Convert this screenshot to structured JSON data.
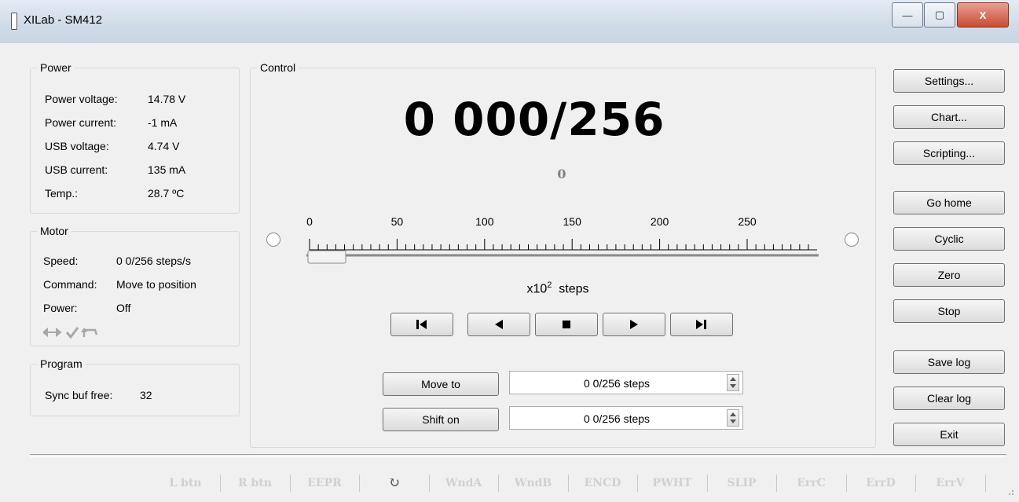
{
  "window": {
    "title": "XILab - SM412",
    "minimize_glyph": "—",
    "maximize_glyph": "▢",
    "close_glyph": "X"
  },
  "power": {
    "title": "Power",
    "rows": [
      {
        "label": "Power voltage:",
        "value": "14.78 V"
      },
      {
        "label": "Power current:",
        "value": "-1 mA"
      },
      {
        "label": "USB voltage:",
        "value": "4.74 V"
      },
      {
        "label": "USB current:",
        "value": "135 mA"
      },
      {
        "label": "Temp.:",
        "value": "28.7 ºC"
      }
    ]
  },
  "motor": {
    "title": "Motor",
    "rows": [
      {
        "label": "Speed:",
        "value": "0 0/256 steps/s"
      },
      {
        "label": "Command:",
        "value": "Move to position"
      },
      {
        "label": "Power:",
        "value": "Off"
      }
    ],
    "status_icons": [
      "arrows-icon",
      "check-icon",
      "return-icon"
    ]
  },
  "program": {
    "title": "Program",
    "sync_label": "Sync buf free:",
    "sync_value": "32"
  },
  "control": {
    "title": "Control",
    "position": "0 000/256",
    "encoder": "0",
    "scale_ticks": [
      "0",
      "50",
      "100",
      "150",
      "200",
      "250"
    ],
    "slider_value": 0,
    "units_prefix": "x10",
    "units_exp": "2",
    "units_suffix": "steps",
    "move_to_label": "Move to",
    "move_to_value": "0 0/256 steps",
    "shift_on_label": "Shift on",
    "shift_on_value": "0 0/256 steps"
  },
  "side_buttons": {
    "settings": "Settings...",
    "chart": "Chart...",
    "scripting": "Scripting...",
    "go_home": "Go home",
    "cyclic": "Cyclic",
    "zero": "Zero",
    "stop": "Stop",
    "save_log": "Save log",
    "clear_log": "Clear log",
    "exit": "Exit"
  },
  "status_bar": [
    "L btn",
    "R btn",
    "EEPR",
    "↻",
    "WndA",
    "WndB",
    "ENCD",
    "PWHT",
    "SLIP",
    "ErrC",
    "ErrD",
    "ErrV"
  ]
}
